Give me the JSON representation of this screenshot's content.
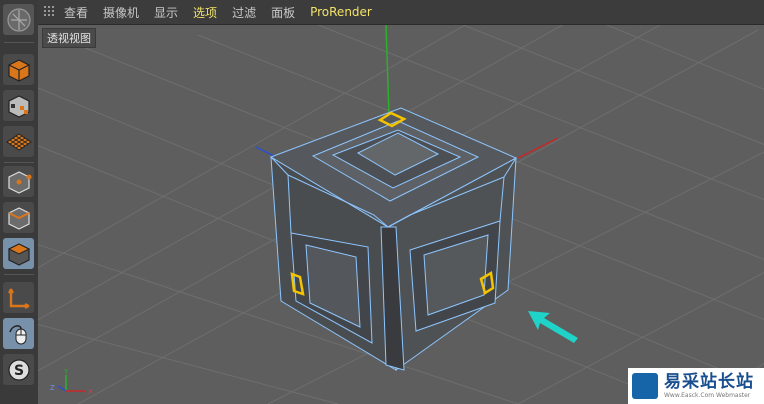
{
  "menu": {
    "items": [
      {
        "label": "查看",
        "highlight": false
      },
      {
        "label": "摄像机",
        "highlight": false
      },
      {
        "label": "显示",
        "highlight": false
      },
      {
        "label": "选项",
        "highlight": true
      },
      {
        "label": "过滤",
        "highlight": false
      },
      {
        "label": "面板",
        "highlight": false
      },
      {
        "label": "ProRender",
        "highlight": true
      }
    ]
  },
  "viewport": {
    "label": "透视视图",
    "gizmo_axes": {
      "y": "Y",
      "z": "Z",
      "x": "X"
    }
  },
  "toolbar": {
    "icons": [
      "cinema4d-logo-icon",
      "model-mode-icon",
      "texture-mode-icon",
      "workplane-mode-icon",
      "points-mode-icon",
      "edges-mode-icon",
      "polygons-mode-icon",
      "axis-mode-icon",
      "tweak-mode-icon",
      "solo-mode-icon"
    ],
    "active": "polygons-mode-icon"
  },
  "colors": {
    "selection": "#f5c400",
    "wire": "#8ec6ff",
    "arrow": "#1fd3c8",
    "axis_x": "#c02020",
    "axis_y": "#20b020",
    "axis_z": "#2a4fd0"
  },
  "watermark": {
    "title": "易采站长站",
    "subtitle": "Www.Easck.Com  Webmaster"
  }
}
